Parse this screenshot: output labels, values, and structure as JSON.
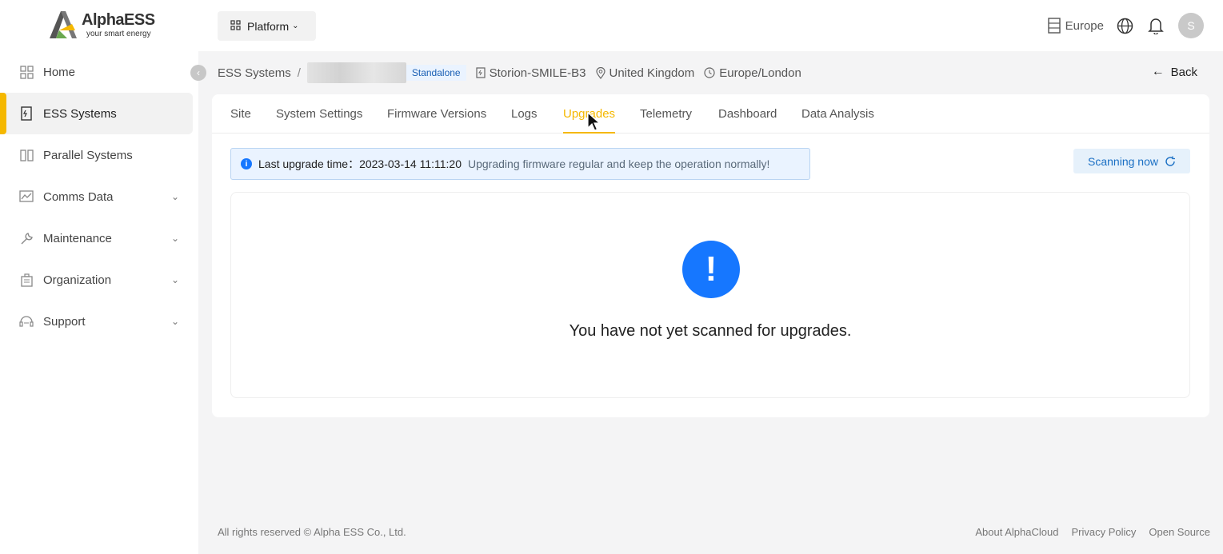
{
  "logo": {
    "brand": "AlphaESS",
    "tagline": "your smart energy"
  },
  "sidebar": {
    "items": [
      {
        "label": "Home",
        "icon": "home-icon",
        "expandable": false,
        "active": false
      },
      {
        "label": "ESS Systems",
        "icon": "ess-systems-icon",
        "expandable": false,
        "active": true
      },
      {
        "label": "Parallel Systems",
        "icon": "parallel-systems-icon",
        "expandable": false,
        "active": false
      },
      {
        "label": "Comms Data",
        "icon": "comms-data-icon",
        "expandable": true,
        "active": false
      },
      {
        "label": "Maintenance",
        "icon": "maintenance-icon",
        "expandable": true,
        "active": false
      },
      {
        "label": "Organization",
        "icon": "organization-icon",
        "expandable": true,
        "active": false
      },
      {
        "label": "Support",
        "icon": "support-icon",
        "expandable": true,
        "active": false
      }
    ]
  },
  "topbar": {
    "platform_label": "Platform",
    "region_label": "Europe",
    "avatar_initial": "S"
  },
  "breadcrumb": {
    "root": "ESS Systems",
    "separator": "/",
    "system_type": "Standalone",
    "model": "Storion-SMILE-B3",
    "country": "United Kingdom",
    "timezone": "Europe/London",
    "back_label": "Back"
  },
  "tabs": [
    {
      "label": "Site",
      "active": false
    },
    {
      "label": "System Settings",
      "active": false
    },
    {
      "label": "Firmware Versions",
      "active": false
    },
    {
      "label": "Logs",
      "active": false
    },
    {
      "label": "Upgrades",
      "active": true
    },
    {
      "label": "Telemetry",
      "active": false
    },
    {
      "label": "Dashboard",
      "active": false
    },
    {
      "label": "Data Analysis",
      "active": false
    }
  ],
  "notice": {
    "label": "Last upgrade time：",
    "time": "2023-03-14 11:11:20",
    "message": "Upgrading firmware regular and keep the operation normally!"
  },
  "scan_button_label": "Scanning now",
  "empty_state": {
    "icon": "exclamation-icon",
    "symbol": "!",
    "text": "You have not yet scanned for upgrades."
  },
  "footer": {
    "copyright": "All rights reserved © Alpha ESS Co., Ltd.",
    "links": [
      "About AlphaCloud",
      "Privacy Policy",
      "Open Source"
    ]
  },
  "colors": {
    "accent": "#f5b800",
    "primary_blue": "#1677ff",
    "notice_bg": "#eaf3ff"
  }
}
